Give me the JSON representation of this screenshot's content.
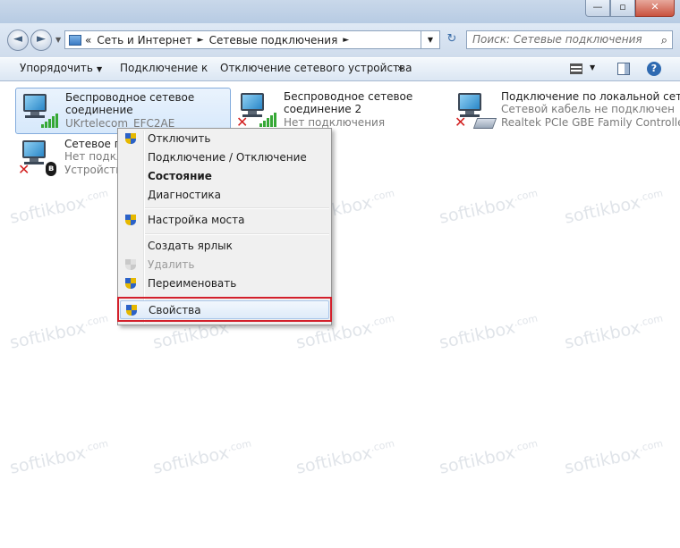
{
  "window": {
    "min_label": "—",
    "max_label": "▫",
    "close_label": "✕"
  },
  "nav": {
    "back_glyph": "◄",
    "forward_glyph": "►",
    "breadcrumb_prefix": "«",
    "breadcrumbs": [
      "Сеть и Интернет",
      "Сетевые подключения"
    ],
    "crumb_separator": "►",
    "search_placeholder": "Поиск: Сетевые подключения",
    "search_glyph": "⌕",
    "refresh_glyph": "↻"
  },
  "toolbar": {
    "organize": "Упорядочить",
    "connect": "Подключение к",
    "disconnect": "Отключение сетевого устройства",
    "more": "»",
    "help": "?"
  },
  "connections": [
    {
      "name_line1": "Беспроводное сетевое",
      "name_line2": "соединение",
      "status": "UKrtelecom_EFC2AE",
      "selected": true
    },
    {
      "name_line1": "Беспроводное сетевое",
      "name_line2": "соединение 2",
      "status": "Нет подключения",
      "selected": false
    },
    {
      "name_line1": "Подключение по локальной сети",
      "status_line1": "Сетевой кабель не подключен",
      "status_line2": "Realtek PCIe GBE Family Controller",
      "selected": false
    },
    {
      "name": "Сетевое по",
      "status_line1": "Нет подкл",
      "status_line2": "Устройства",
      "selected": false
    }
  ],
  "context_menu": {
    "items": [
      {
        "label": "Отключить",
        "shield": true
      },
      {
        "label": "Подключение / Отключение",
        "shield": false
      },
      {
        "label": "Состояние",
        "shield": false,
        "bold": true
      },
      {
        "label": "Диагностика",
        "shield": false
      },
      {
        "label": "Настройка моста",
        "shield": true
      },
      {
        "label": "Создать ярлык",
        "shield": false
      },
      {
        "label": "Удалить",
        "shield": true,
        "disabled": true
      },
      {
        "label": "Переименовать",
        "shield": true
      },
      {
        "label": "Свойства",
        "shield": true,
        "highlighted": true
      }
    ]
  },
  "watermark": {
    "text": "softikbox",
    "suffix": ".com"
  },
  "colors": {
    "highlight_box": "#d3202b",
    "selection": "#d6e8fb",
    "signal": "#36a836",
    "error": "#d21f1f"
  }
}
